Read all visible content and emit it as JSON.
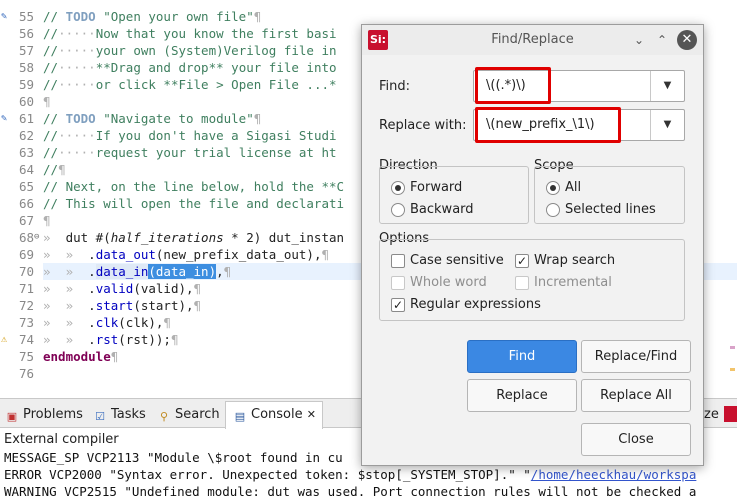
{
  "editor": {
    "lines": [
      {
        "n": "55",
        "mark": "task"
      },
      {
        "n": "56"
      },
      {
        "n": "57"
      },
      {
        "n": "58"
      },
      {
        "n": "59"
      },
      {
        "n": "60"
      },
      {
        "n": "61",
        "mark": "task"
      },
      {
        "n": "62"
      },
      {
        "n": "63"
      },
      {
        "n": "64"
      },
      {
        "n": "65"
      },
      {
        "n": "66"
      },
      {
        "n": "67"
      },
      {
        "n": "68",
        "fold": "⊖"
      },
      {
        "n": "69"
      },
      {
        "n": "70"
      },
      {
        "n": "71"
      },
      {
        "n": "72"
      },
      {
        "n": "73"
      },
      {
        "n": "74",
        "mark": "warn"
      },
      {
        "n": "75"
      },
      {
        "n": "76"
      }
    ],
    "code": {
      "l55_a": "// ",
      "l55_todo": "TODO",
      "l55_b": " \"Open your own file\"",
      "l55_c": "¶",
      "l56_a": "//",
      "l56_ws": "·····",
      "l56_b": "Now that you know the first basi",
      "l57_a": "//",
      "l57_ws": "·····",
      "l57_b": "your own (System)Verilog file in",
      "l58_a": "//",
      "l58_ws": "·····",
      "l58_b": "**Drag and drop** your file into",
      "l59_a": "//",
      "l59_ws": "·····",
      "l59_b": "or click **File > Open File ...*",
      "l60": "¶",
      "l61_a": "// ",
      "l61_todo": "TODO",
      "l61_b": " \"Navigate to module\"",
      "l61_c": "¶",
      "l62_a": "//",
      "l62_ws": "·····",
      "l62_b": "If you don't have a Sigasi Studi",
      "l63_a": "//",
      "l63_ws": "·····",
      "l63_b": "request your trial license at ht",
      "l64_a": "//",
      "l64_c": "¶",
      "l65": "// Next, on the line below, hold the **C",
      "l66": "// This will open the file and declarati",
      "l67": "¶",
      "l68_ws": "»  ",
      "l68_a": "dut #(",
      "l68_p": "half_iterations",
      "l68_b": " * 2) dut_instan",
      "l69_ws": "»  »  ",
      "l69_a": ".",
      "l69_id": "data_out",
      "l69_b": "(new_prefix_data_out),",
      "l69_c": "¶",
      "l70_ws": "»  »  ",
      "l70_a": ".",
      "l70_id": "data_in",
      "l70_sel": "(data_in)",
      "l70_b": ",",
      "l70_c": "¶",
      "l71_ws": "»  »  ",
      "l71_a": ".",
      "l71_id": "valid",
      "l71_b": "(valid),",
      "l71_c": "¶",
      "l72_ws": "»  »  ",
      "l72_a": ".",
      "l72_id": "start",
      "l72_b": "(start),",
      "l72_c": "¶",
      "l73_ws": "»  »  ",
      "l73_a": ".",
      "l73_id": "clk",
      "l73_b": "(clk),",
      "l73_c": "¶",
      "l74_ws": "»  »  ",
      "l74_a": ".",
      "l74_id": "rst",
      "l74_b": "(rst));",
      "l74_c": "¶",
      "l75_kw": "endmodule",
      "l75_c": "¶"
    }
  },
  "bottom_tabs": {
    "problems": "Problems",
    "tasks": "Tasks",
    "search": "Search",
    "console": "Console",
    "console_close": "✕",
    "right_partial": "ze"
  },
  "console": {
    "label": "External compiler",
    "line1": "MESSAGE_SP VCP2113 \"Module \\$root found in cu",
    "line2_a": "ERROR VCP2000 \"Syntax error. Unexpected token: $stop[_SYSTEM_STOP].\" \"",
    "line2_link": "/home/heeckhau/workspa",
    "line3": "WARNING VCP2515 \"Undefined module: dut was used. Port connection rules will not be checked a"
  },
  "dialog": {
    "logo": "Si:",
    "title": "Find/Replace",
    "find_label": "Find:",
    "find_value": "\\((.*)\\)",
    "replace_label": "Replace with:",
    "replace_value": "\\(new_prefix_\\1\\)",
    "direction_title": "Direction",
    "direction_forward": "Forward",
    "direction_backward": "Backward",
    "scope_title": "Scope",
    "scope_all": "All",
    "scope_selected": "Selected lines",
    "options_title": "Options",
    "opt_case": "Case sensitive",
    "opt_wrap": "Wrap search",
    "opt_whole": "Whole word",
    "opt_incremental": "Incremental",
    "opt_regex": "Regular expressions",
    "btn_find": "Find",
    "btn_replace_find": "Replace/Find",
    "btn_replace": "Replace",
    "btn_replace_all": "Replace All",
    "btn_close": "Close",
    "state": {
      "direction": "Forward",
      "scope": "All",
      "case_sensitive": false,
      "wrap_search": true,
      "whole_word": false,
      "incremental": false,
      "regular_expressions": true
    }
  },
  "colors": {
    "highlight_box": "#e00000",
    "primary_button": "#3b88e3",
    "comment": "#3f7f5f",
    "keyword": "#7f0055",
    "selection": "#3d8ee0"
  }
}
